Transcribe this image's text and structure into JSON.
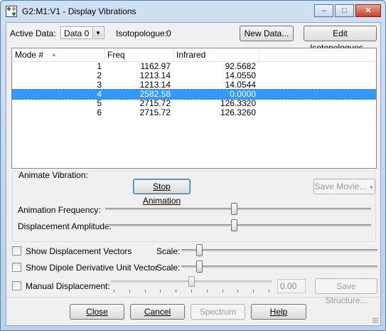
{
  "window": {
    "title": "G2:M1:V1 - Display Vibrations",
    "minimize_glyph": "–",
    "maximize_glyph": "□",
    "close_glyph": "✕"
  },
  "toolbar": {
    "active_data_label": "Active Data:",
    "active_data_value": "Data 0",
    "isotopologue_label": "Isotopologue:",
    "isotopologue_value": "0",
    "new_data_button": "New Data...",
    "edit_isotopologues_button": "Edit Isotopologues..."
  },
  "table": {
    "columns": [
      "Mode #",
      "Freq",
      "Infrared"
    ],
    "sort_indicator": "▲",
    "rows": [
      {
        "mode": "1",
        "freq": "1162.97",
        "ir": "92.5682"
      },
      {
        "mode": "2",
        "freq": "1213.14",
        "ir": "14.0550"
      },
      {
        "mode": "3",
        "freq": "1213.14",
        "ir": "14.0544"
      },
      {
        "mode": "4",
        "freq": "2582.58",
        "ir": "0.0000"
      },
      {
        "mode": "5",
        "freq": "2715.72",
        "ir": "126.3320"
      },
      {
        "mode": "6",
        "freq": "2715.72",
        "ir": "126.3260"
      }
    ],
    "selected_index": 3
  },
  "animate": {
    "group_label": "Animate Vibration:",
    "stop_button": "Stop Animation",
    "save_movie_button": "Save Movie...",
    "frequency_label": "Animation Frequency:",
    "frequency_level": 0.485,
    "amplitude_label": "Displacement Amplitude:",
    "amplitude_level": 0.485
  },
  "options": {
    "show_vectors_label": "Show Displacement Vectors",
    "show_vectors_checked": false,
    "scale_label": "Scale:",
    "vectors_scale_level": 0.08,
    "show_dipole_label": "Show Dipole Derivative Unit Vector",
    "show_dipole_checked": false,
    "dipole_scale_level": 0.08,
    "manual_label": "Manual Displacement:",
    "manual_checked": false,
    "manual_level": 0.5,
    "manual_value": "0.00",
    "save_structure_button": "Save Structure..."
  },
  "footer": {
    "close_button": "Close",
    "cancel_button": "Cancel",
    "spectrum_button": "Spectrum",
    "help_button": "Help"
  }
}
